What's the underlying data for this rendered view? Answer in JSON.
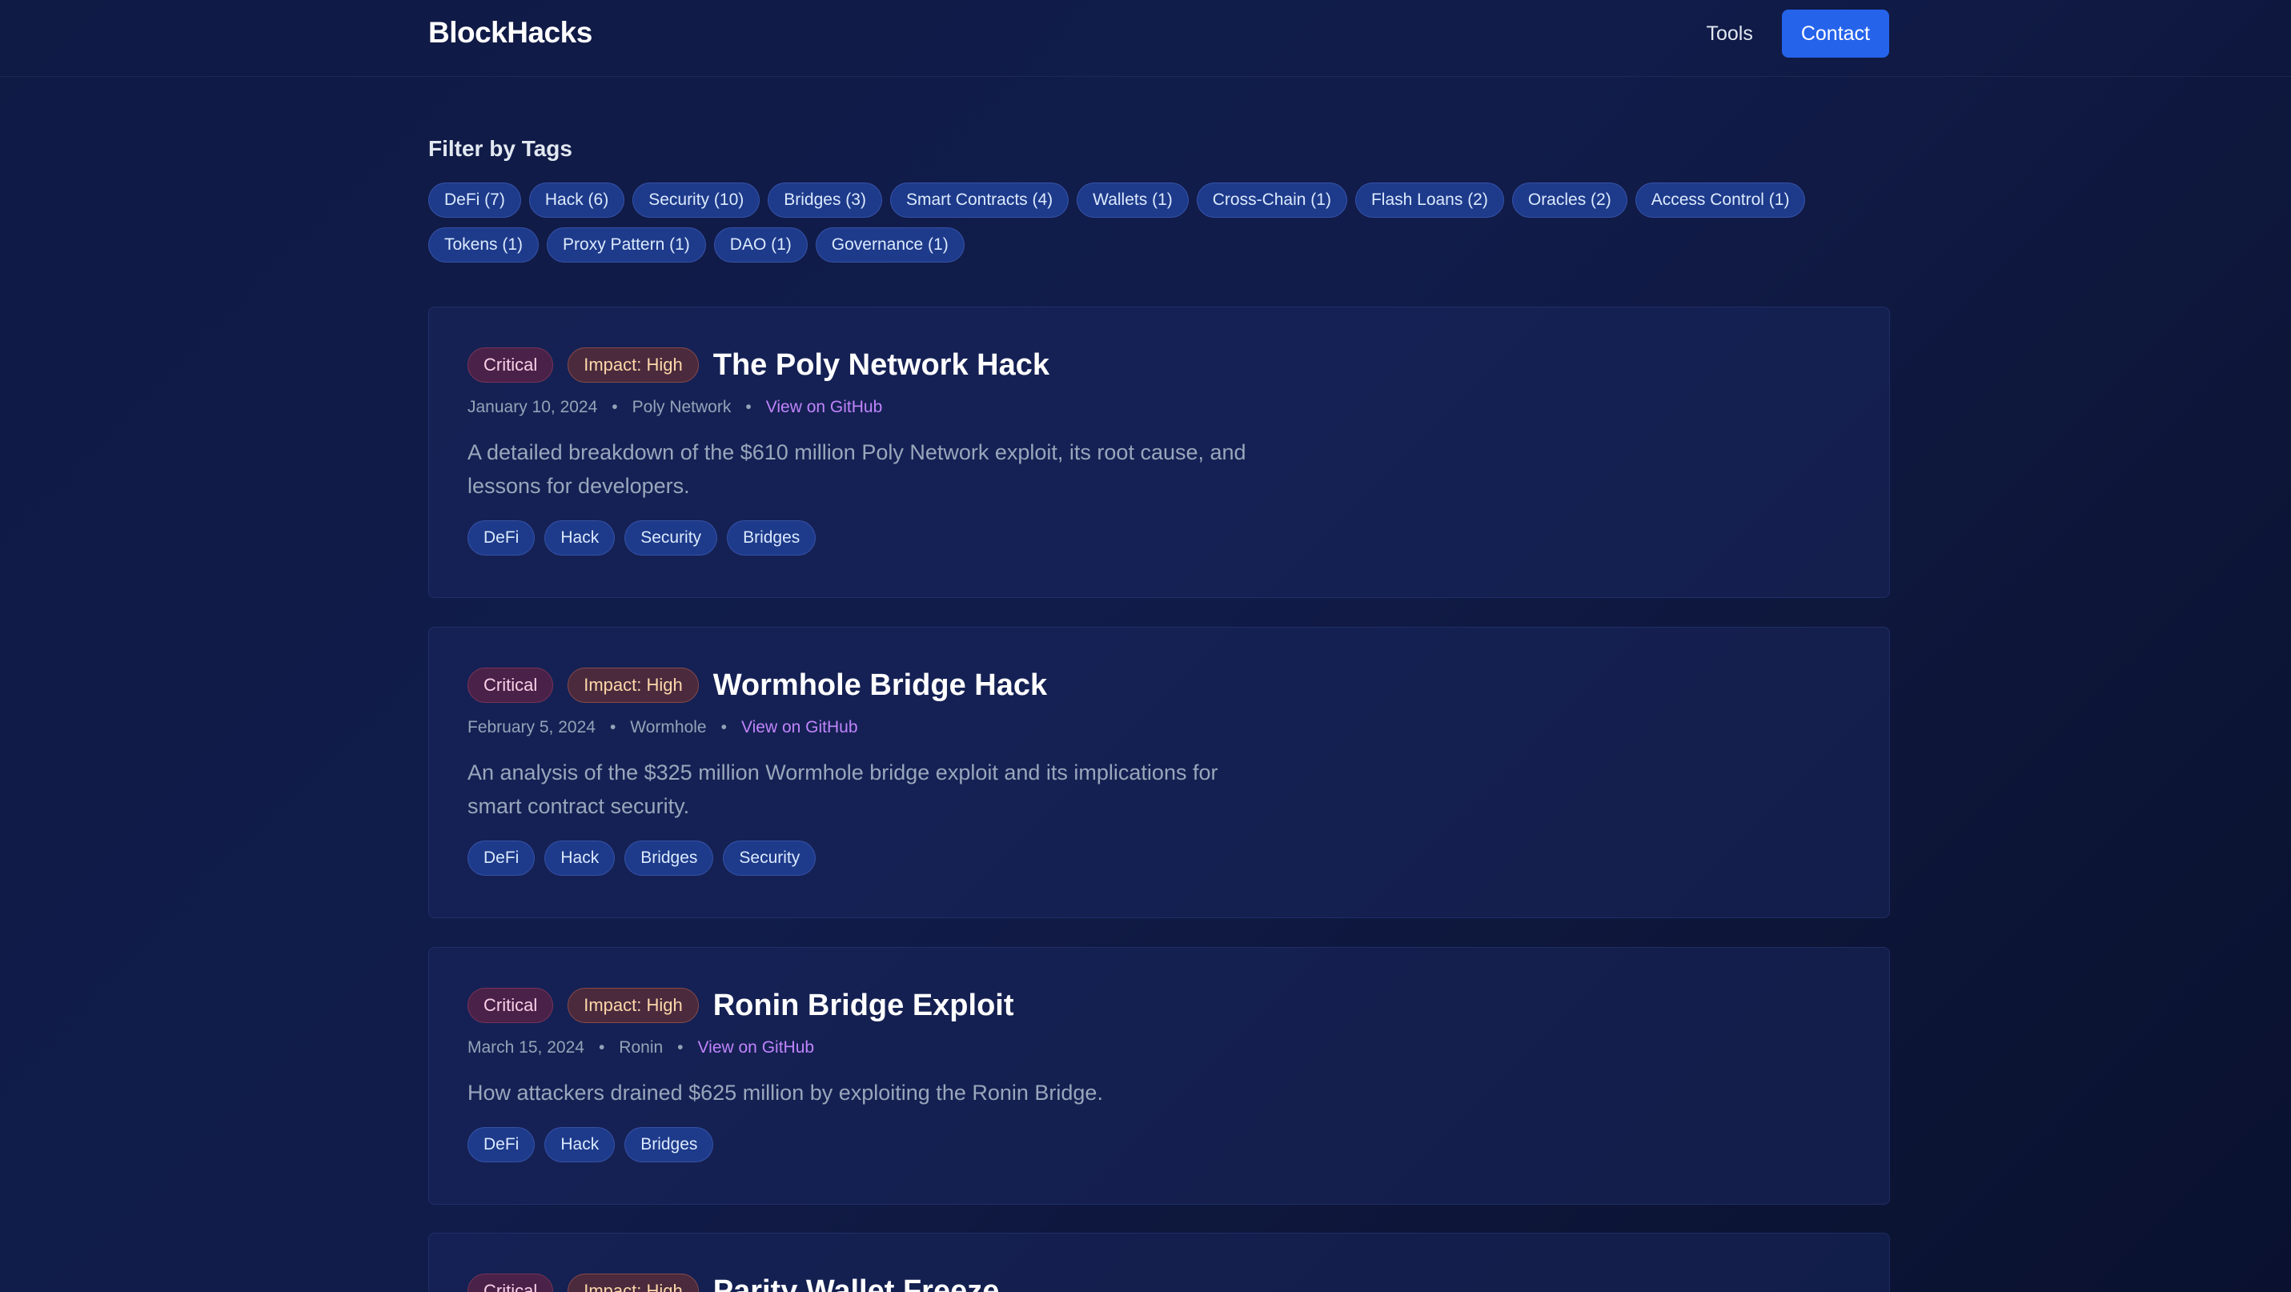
{
  "nav": {
    "brand": "BlockHacks",
    "tools_label": "Tools",
    "contact_label": "Contact"
  },
  "filter": {
    "title": "Filter by Tags",
    "tags": [
      "DeFi (7)",
      "Hack (6)",
      "Security (10)",
      "Bridges (3)",
      "Smart Contracts (4)",
      "Wallets (1)",
      "Cross-Chain (1)",
      "Flash Loans (2)",
      "Oracles (2)",
      "Access Control (1)",
      "Tokens (1)",
      "Proxy Pattern (1)",
      "DAO (1)",
      "Governance (1)"
    ]
  },
  "posts": [
    {
      "severity": "Critical",
      "impact": "Impact: High",
      "title": "The Poly Network Hack",
      "date": "January 10, 2024",
      "project": "Poly Network",
      "link": "View on GitHub",
      "description": "A detailed breakdown of the $610 million Poly Network exploit, its root cause, and lessons for developers.",
      "tags": [
        "DeFi",
        "Hack",
        "Security",
        "Bridges"
      ]
    },
    {
      "severity": "Critical",
      "impact": "Impact: High",
      "title": "Wormhole Bridge Hack",
      "date": "February 5, 2024",
      "project": "Wormhole",
      "link": "View on GitHub",
      "description": "An analysis of the $325 million Wormhole bridge exploit and its implications for smart contract security.",
      "tags": [
        "DeFi",
        "Hack",
        "Bridges",
        "Security"
      ]
    },
    {
      "severity": "Critical",
      "impact": "Impact: High",
      "title": "Ronin Bridge Exploit",
      "date": "March 15, 2024",
      "project": "Ronin",
      "link": "View on GitHub",
      "description": "How attackers drained $625 million by exploiting the Ronin Bridge.",
      "tags": [
        "DeFi",
        "Hack",
        "Bridges"
      ]
    },
    {
      "severity": "Critical",
      "impact": "Impact: High",
      "title": "Parity Wallet Freeze"
    }
  ],
  "colors": {
    "accent": "#2563eb",
    "link": "#c084fc",
    "tag_bg": "#1e3a8a"
  }
}
